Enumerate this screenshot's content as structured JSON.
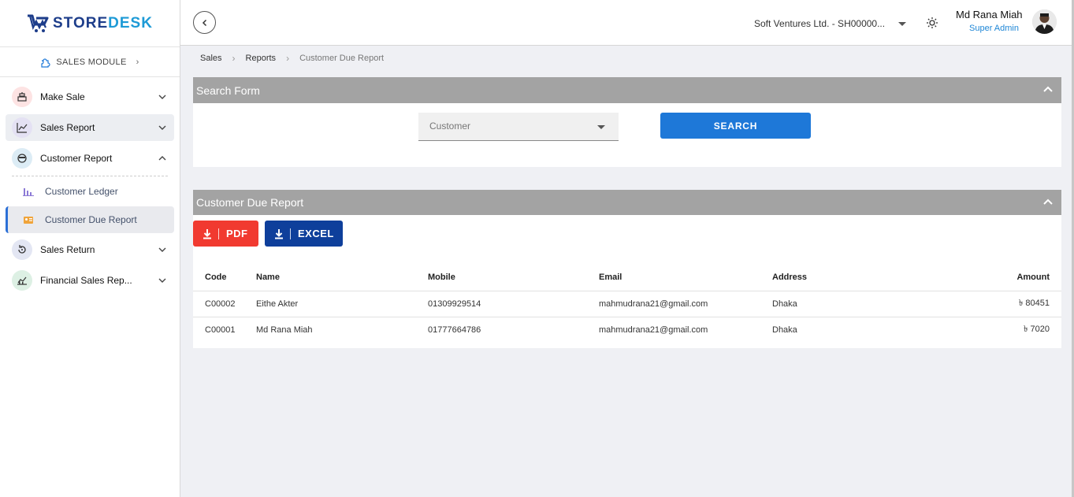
{
  "brand": {
    "logo_left": "STORE",
    "logo_right": "DESK"
  },
  "sidebar": {
    "module_label": "SALES MODULE",
    "items": [
      {
        "label": "Make Sale",
        "icon": "cash-register-icon"
      },
      {
        "label": "Sales Report",
        "icon": "line-chart-icon"
      },
      {
        "label": "Customer Report",
        "icon": "customer-face-icon"
      },
      {
        "label": "Sales Return",
        "icon": "return-icon"
      },
      {
        "label": "Financial Sales Rep...",
        "icon": "finance-chart-icon"
      }
    ],
    "sub_items": [
      {
        "label": "Customer Ledger",
        "icon": "bar-chart-icon"
      },
      {
        "label": "Customer Due Report",
        "icon": "id-card-icon"
      }
    ]
  },
  "header": {
    "company": "Soft Ventures Ltd. - SH00000...",
    "user_name": "Md Rana Miah",
    "user_role": "Super Admin"
  },
  "breadcrumb": [
    "Sales",
    "Reports",
    "Customer Due Report"
  ],
  "search_form": {
    "title": "Search Form",
    "customer_placeholder": "Customer",
    "search_label": "SEARCH"
  },
  "report": {
    "title": "Customer Due Report",
    "pdf_label": "PDF",
    "excel_label": "EXCEL",
    "columns": [
      "Code",
      "Name",
      "Mobile",
      "Email",
      "Address",
      "Amount"
    ],
    "rows": [
      {
        "code": "C00002",
        "name": "Eithe Akter",
        "mobile": "01309929514",
        "email": "mahmudrana21@gmail.com",
        "address": "Dhaka",
        "amount": "৳ 80451"
      },
      {
        "code": "C00001",
        "name": "Md Rana Miah",
        "mobile": "01777664786",
        "email": "mahmudrana21@gmail.com",
        "address": "Dhaka",
        "amount": "৳ 7020"
      }
    ]
  },
  "colors": {
    "accent": "#1e78d8",
    "pdf": "#f13a30",
    "excel": "#0e3f9b",
    "panel_header": "#a3a3a3",
    "role": "#1e86d6"
  }
}
